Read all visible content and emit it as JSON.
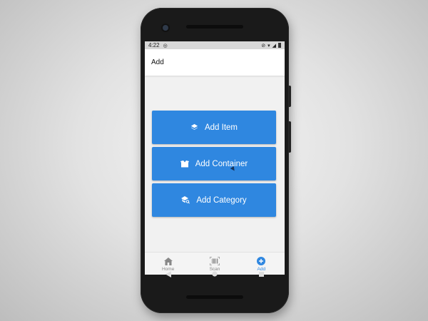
{
  "status_bar": {
    "time": "4:22",
    "left_icons": [
      "data-saver-icon"
    ],
    "right_icons": [
      "no-sim-icon",
      "wifi-icon",
      "signal-icon",
      "battery-icon"
    ]
  },
  "app_bar": {
    "title": "Add"
  },
  "actions": [
    {
      "label": "Add Item",
      "icon": "layers-icon"
    },
    {
      "label": "Add Container",
      "icon": "box-icon"
    },
    {
      "label": "Add Category",
      "icon": "category-search-icon"
    }
  ],
  "bottom_nav": [
    {
      "label": "Home",
      "icon": "home-icon",
      "active": false
    },
    {
      "label": "Scan",
      "icon": "barcode-scan-icon",
      "active": false
    },
    {
      "label": "Add",
      "icon": "add-circle-icon",
      "active": true
    }
  ],
  "system_nav": [
    "back-icon",
    "home-circle-icon",
    "recents-icon"
  ],
  "colors": {
    "accent": "#2f87e0",
    "screen_background": "#f1f1f1",
    "phone_body": "#1a1a1a",
    "inactive_nav": "#888888"
  }
}
